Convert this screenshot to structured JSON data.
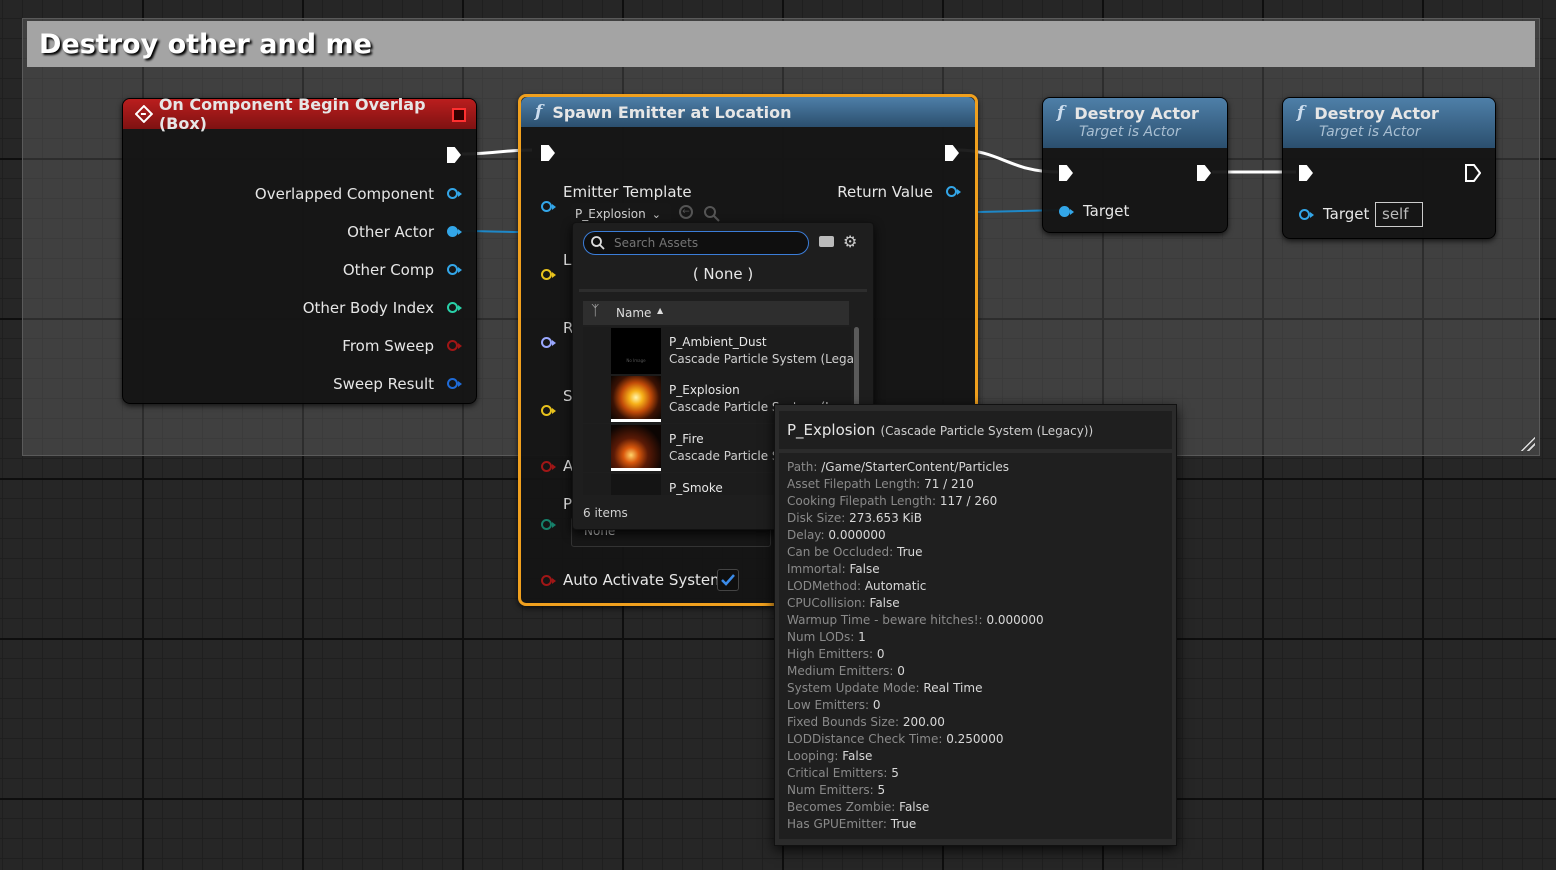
{
  "comment": {
    "title": "Destroy other and me"
  },
  "event_node": {
    "title": "On Component Begin Overlap (Box)",
    "pins": [
      {
        "label": "Overlapped Component",
        "color": "#33a6e8"
      },
      {
        "label": "Other Actor",
        "color": "#33a6e8"
      },
      {
        "label": "Other Comp",
        "color": "#33a6e8"
      },
      {
        "label": "Other Body Index",
        "color": "#29d0a8"
      },
      {
        "label": "From Sweep",
        "color": "#a01616"
      },
      {
        "label": "Sweep Result",
        "color": "#1f6bd8"
      }
    ]
  },
  "spawn_node": {
    "title": "Spawn Emitter at Location",
    "emitter_label": "Emitter Template",
    "emitter_value": "P_Explosion",
    "return_label": "Return Value",
    "hidden_labels": [
      "L",
      "R",
      "S",
      "A",
      "P"
    ],
    "none_text": "None",
    "auto_activate_label": "Auto Activate System",
    "auto_activate_checked": true
  },
  "asset_picker": {
    "search_placeholder": "Search Assets",
    "none_option": "( None )",
    "column_name": "Name",
    "items": [
      {
        "name": "P_Ambient_Dust",
        "type": "Cascade Particle System (Legac"
      },
      {
        "name": "P_Explosion",
        "type": "Cascade Particle System (Legacy)"
      },
      {
        "name": "P_Fire",
        "type": "Cascade Particle System (Legacy)"
      },
      {
        "name": "P_Smoke",
        "type": ""
      }
    ],
    "item_count": "6 items",
    "no_image_text": "No Image"
  },
  "destroy_nodes": [
    {
      "title": "Destroy Actor",
      "subtitle": "Target is Actor",
      "target_label": "Target"
    },
    {
      "title": "Destroy Actor",
      "subtitle": "Target is Actor",
      "target_label": "Target",
      "target_value": "self"
    }
  ],
  "tooltip": {
    "title": "P_Explosion",
    "type": "(Cascade Particle System (Legacy))",
    "rows": [
      {
        "k": "Path:",
        "v": "/Game/StarterContent/Particles"
      },
      {
        "k": "Asset Filepath Length:",
        "v": "71 / 210"
      },
      {
        "k": "Cooking Filepath Length:",
        "v": "117 / 260"
      },
      {
        "k": "Disk Size:",
        "v": "273.653 KiB"
      },
      {
        "k": "Delay:",
        "v": "0.000000"
      },
      {
        "k": "Can be Occluded:",
        "v": "True"
      },
      {
        "k": "Immortal:",
        "v": "False"
      },
      {
        "k": "LODMethod:",
        "v": "Automatic"
      },
      {
        "k": "CPUCollision:",
        "v": "False"
      },
      {
        "k": "Warmup Time - beware hitches!:",
        "v": "0.000000"
      },
      {
        "k": "Num LODs:",
        "v": "1"
      },
      {
        "k": "High Emitters:",
        "v": "0"
      },
      {
        "k": "Medium Emitters:",
        "v": "0"
      },
      {
        "k": "System Update Mode:",
        "v": "Real Time"
      },
      {
        "k": "Low Emitters:",
        "v": "0"
      },
      {
        "k": "Fixed Bounds Size:",
        "v": "200.00"
      },
      {
        "k": "LODDistance Check Time:",
        "v": "0.250000"
      },
      {
        "k": "Looping:",
        "v": "False"
      },
      {
        "k": "Critical Emitters:",
        "v": "5"
      },
      {
        "k": "Num Emitters:",
        "v": "5"
      },
      {
        "k": "Becomes Zombie:",
        "v": "False"
      },
      {
        "k": "Has GPUEmitter:",
        "v": "True"
      }
    ]
  },
  "colors": {
    "event_header": "#b21c1c",
    "func_header": "#3f6a8e",
    "selection_outline": "#f0a01e",
    "object_pin": "#33a6e8",
    "vector_pin": "#e8c21c",
    "rotator_pin": "#9aa8ff",
    "bool_pin": "#a01616"
  }
}
